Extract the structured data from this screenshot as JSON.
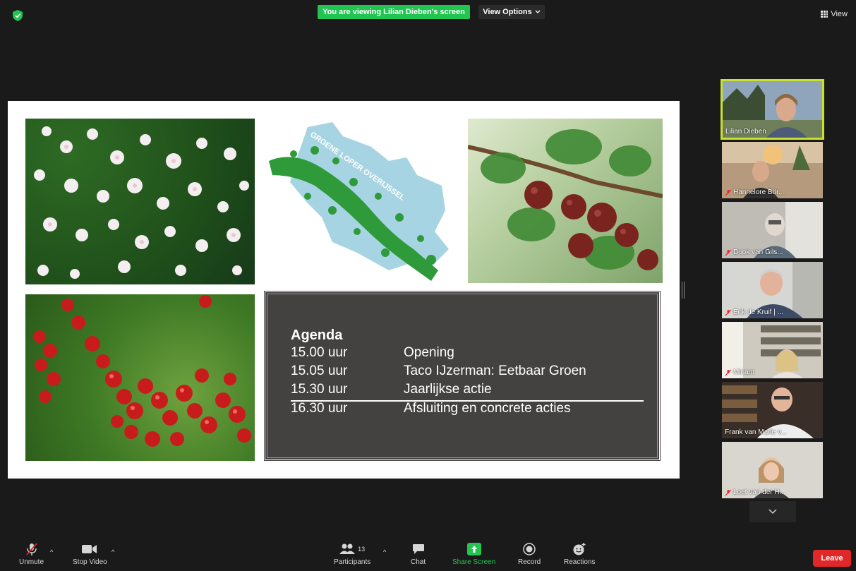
{
  "banner": {
    "viewing_text": "You are viewing Lilian Dieben's screen"
  },
  "view_options": {
    "label": "View Options"
  },
  "view_button": {
    "label": "View"
  },
  "slide": {
    "logo_text": "GROENE LOPER OVERIJSSEL",
    "agenda": {
      "title": "Agenda",
      "items": [
        {
          "time": "15.00 uur",
          "label": "Opening"
        },
        {
          "time": "15.05 uur",
          "label": "Taco IJzerman: Eetbaar Groen"
        },
        {
          "time": "15.30 uur",
          "label": "Jaarlijkse actie"
        },
        {
          "time": "16.30 uur",
          "label": "Afsluiting en concrete acties"
        }
      ]
    }
  },
  "participants_gallery": [
    {
      "name": "Lilian Dieben",
      "muted": false,
      "active": true
    },
    {
      "name": "Hannelore Bör...",
      "muted": true,
      "active": false
    },
    {
      "name": "Dook van Gils...",
      "muted": true,
      "active": false
    },
    {
      "name": "Erik de Kruif | ...",
      "muted": true,
      "active": false
    },
    {
      "name": "Miriam",
      "muted": true,
      "active": false
    },
    {
      "name": "Frank van Marle v...",
      "muted": false,
      "active": false
    },
    {
      "name": "Loet van der H...",
      "muted": true,
      "active": false
    }
  ],
  "toolbar": {
    "unmute": "Unmute",
    "stop_video": "Stop Video",
    "participants": "Participants",
    "participants_count": "13",
    "chat": "Chat",
    "share_screen": "Share Screen",
    "record": "Record",
    "reactions": "Reactions",
    "leave": "Leave"
  },
  "colors": {
    "accent_green": "#23c552",
    "active_speaker": "#c8e12e",
    "leave_red": "#e02828",
    "agenda_bg": "#444141"
  }
}
